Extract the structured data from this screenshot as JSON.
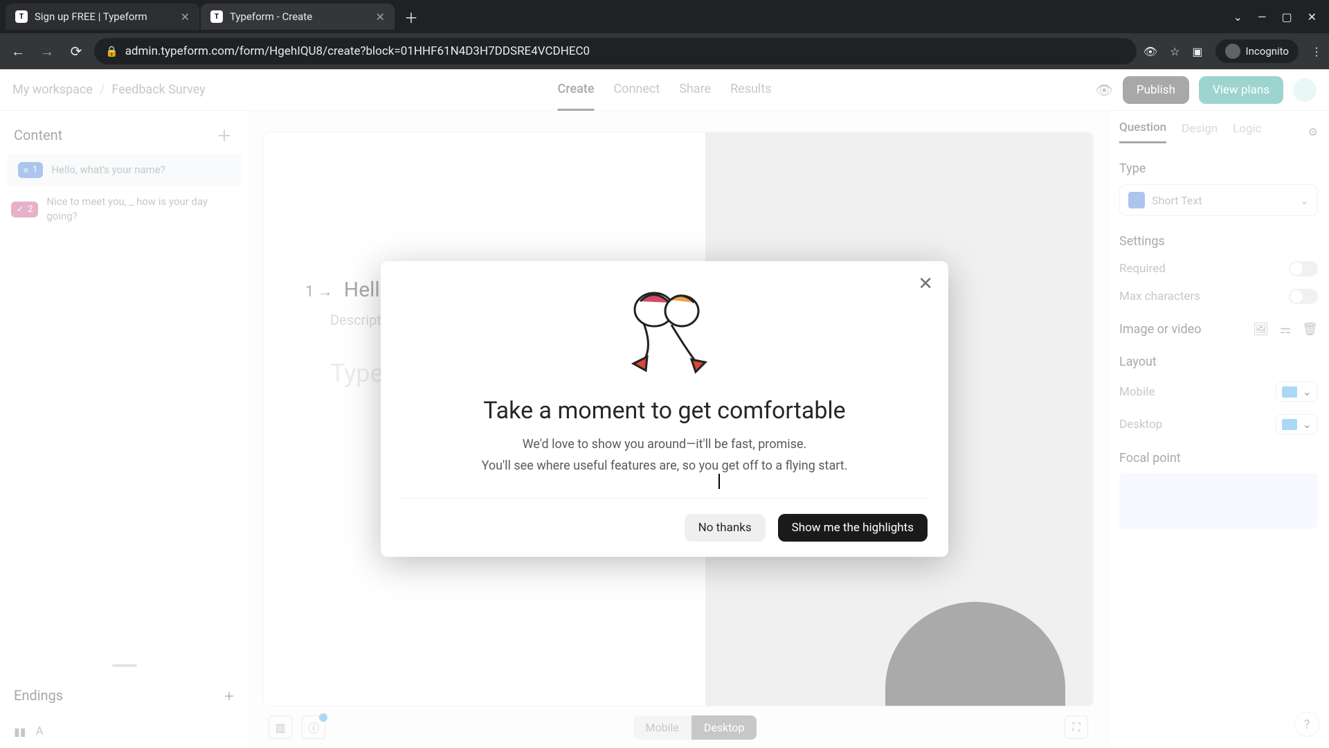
{
  "browser": {
    "tabs": [
      {
        "title": "Sign up FREE | Typeform"
      },
      {
        "title": "Typeform - Create"
      }
    ],
    "url": "admin.typeform.com/form/HgehIQU8/create?block=01HHF61N4D3H7DDSRE4VCDHEC0",
    "incognito_label": "Incognito"
  },
  "header": {
    "breadcrumb": {
      "workspace": "My workspace",
      "form": "Feedback Survey"
    },
    "tabs": {
      "create": "Create",
      "connect": "Connect",
      "share": "Share",
      "results": "Results"
    },
    "publish": "Publish",
    "view_plans": "View plans"
  },
  "left": {
    "content_title": "Content",
    "q1": {
      "num": "1",
      "text": "Hello, what's your name?"
    },
    "q2": {
      "num": "2",
      "text": "Nice to meet you, _ how is your day going?"
    },
    "endings_title": "Endings",
    "ending_a": "A"
  },
  "canvas": {
    "qnum": "1 →",
    "qtitle": "Hello, w",
    "qdesc": "Descripti",
    "qinput": "Type"
  },
  "bottom": {
    "mobile": "Mobile",
    "desktop": "Desktop"
  },
  "right": {
    "tabs": {
      "question": "Question",
      "design": "Design",
      "logic": "Logic"
    },
    "type_label": "Type",
    "type_value": "Short Text",
    "settings_label": "Settings",
    "required": "Required",
    "max_chars": "Max characters",
    "image_video": "Image or video",
    "layout_label": "Layout",
    "mobile": "Mobile",
    "desktop": "Desktop",
    "focal": "Focal point"
  },
  "modal": {
    "title": "Take a moment to get comfortable",
    "line1": "We'd love to show you around—it'll be fast, promise.",
    "line2": "You'll see where useful features are, so you get off to a flying start.",
    "no_thanks": "No thanks",
    "show": "Show me the highlights"
  }
}
